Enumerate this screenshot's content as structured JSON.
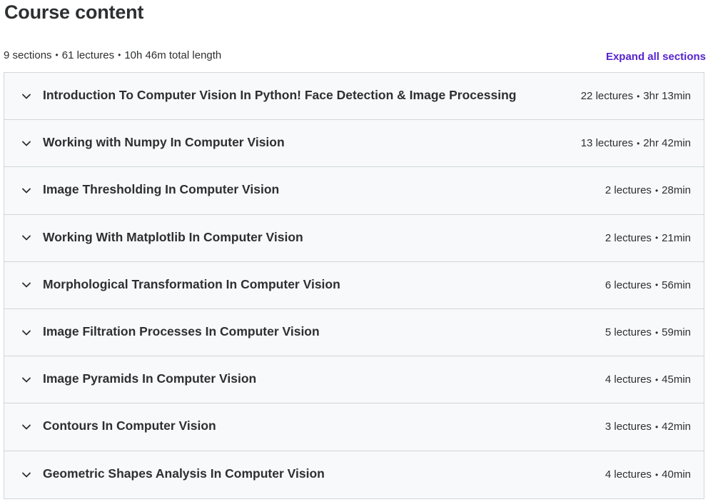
{
  "header": {
    "title": "Course content",
    "sections_count": "9 sections",
    "lectures_count": "61 lectures",
    "total_length": "10h 46m total length",
    "separator": "•",
    "expand_all_label": "Expand all sections"
  },
  "colors": {
    "accent": "#5624d0",
    "text": "#2d2f31",
    "section_bg": "#f7f9fa",
    "border": "#d1d7dc"
  },
  "icons": {
    "section_toggle": "chevron-down-icon"
  },
  "sections": [
    {
      "title": "Introduction To Computer Vision In Python! Face Detection & Image Processing",
      "lectures": "22 lectures",
      "duration": "3hr 13min"
    },
    {
      "title": "Working with Numpy In Computer Vision",
      "lectures": "13 lectures",
      "duration": "2hr 42min"
    },
    {
      "title": "Image Thresholding In Computer Vision",
      "lectures": "2 lectures",
      "duration": "28min"
    },
    {
      "title": "Working With Matplotlib In Computer Vision",
      "lectures": "2 lectures",
      "duration": "21min"
    },
    {
      "title": "Morphological Transformation In Computer Vision",
      "lectures": "6 lectures",
      "duration": "56min"
    },
    {
      "title": "Image Filtration Processes In Computer Vision",
      "lectures": "5 lectures",
      "duration": "59min"
    },
    {
      "title": "Image Pyramids In Computer Vision",
      "lectures": "4 lectures",
      "duration": "45min"
    },
    {
      "title": "Contours In Computer Vision",
      "lectures": "3 lectures",
      "duration": "42min"
    },
    {
      "title": "Geometric Shapes Analysis In Computer Vision",
      "lectures": "4 lectures",
      "duration": "40min"
    }
  ]
}
